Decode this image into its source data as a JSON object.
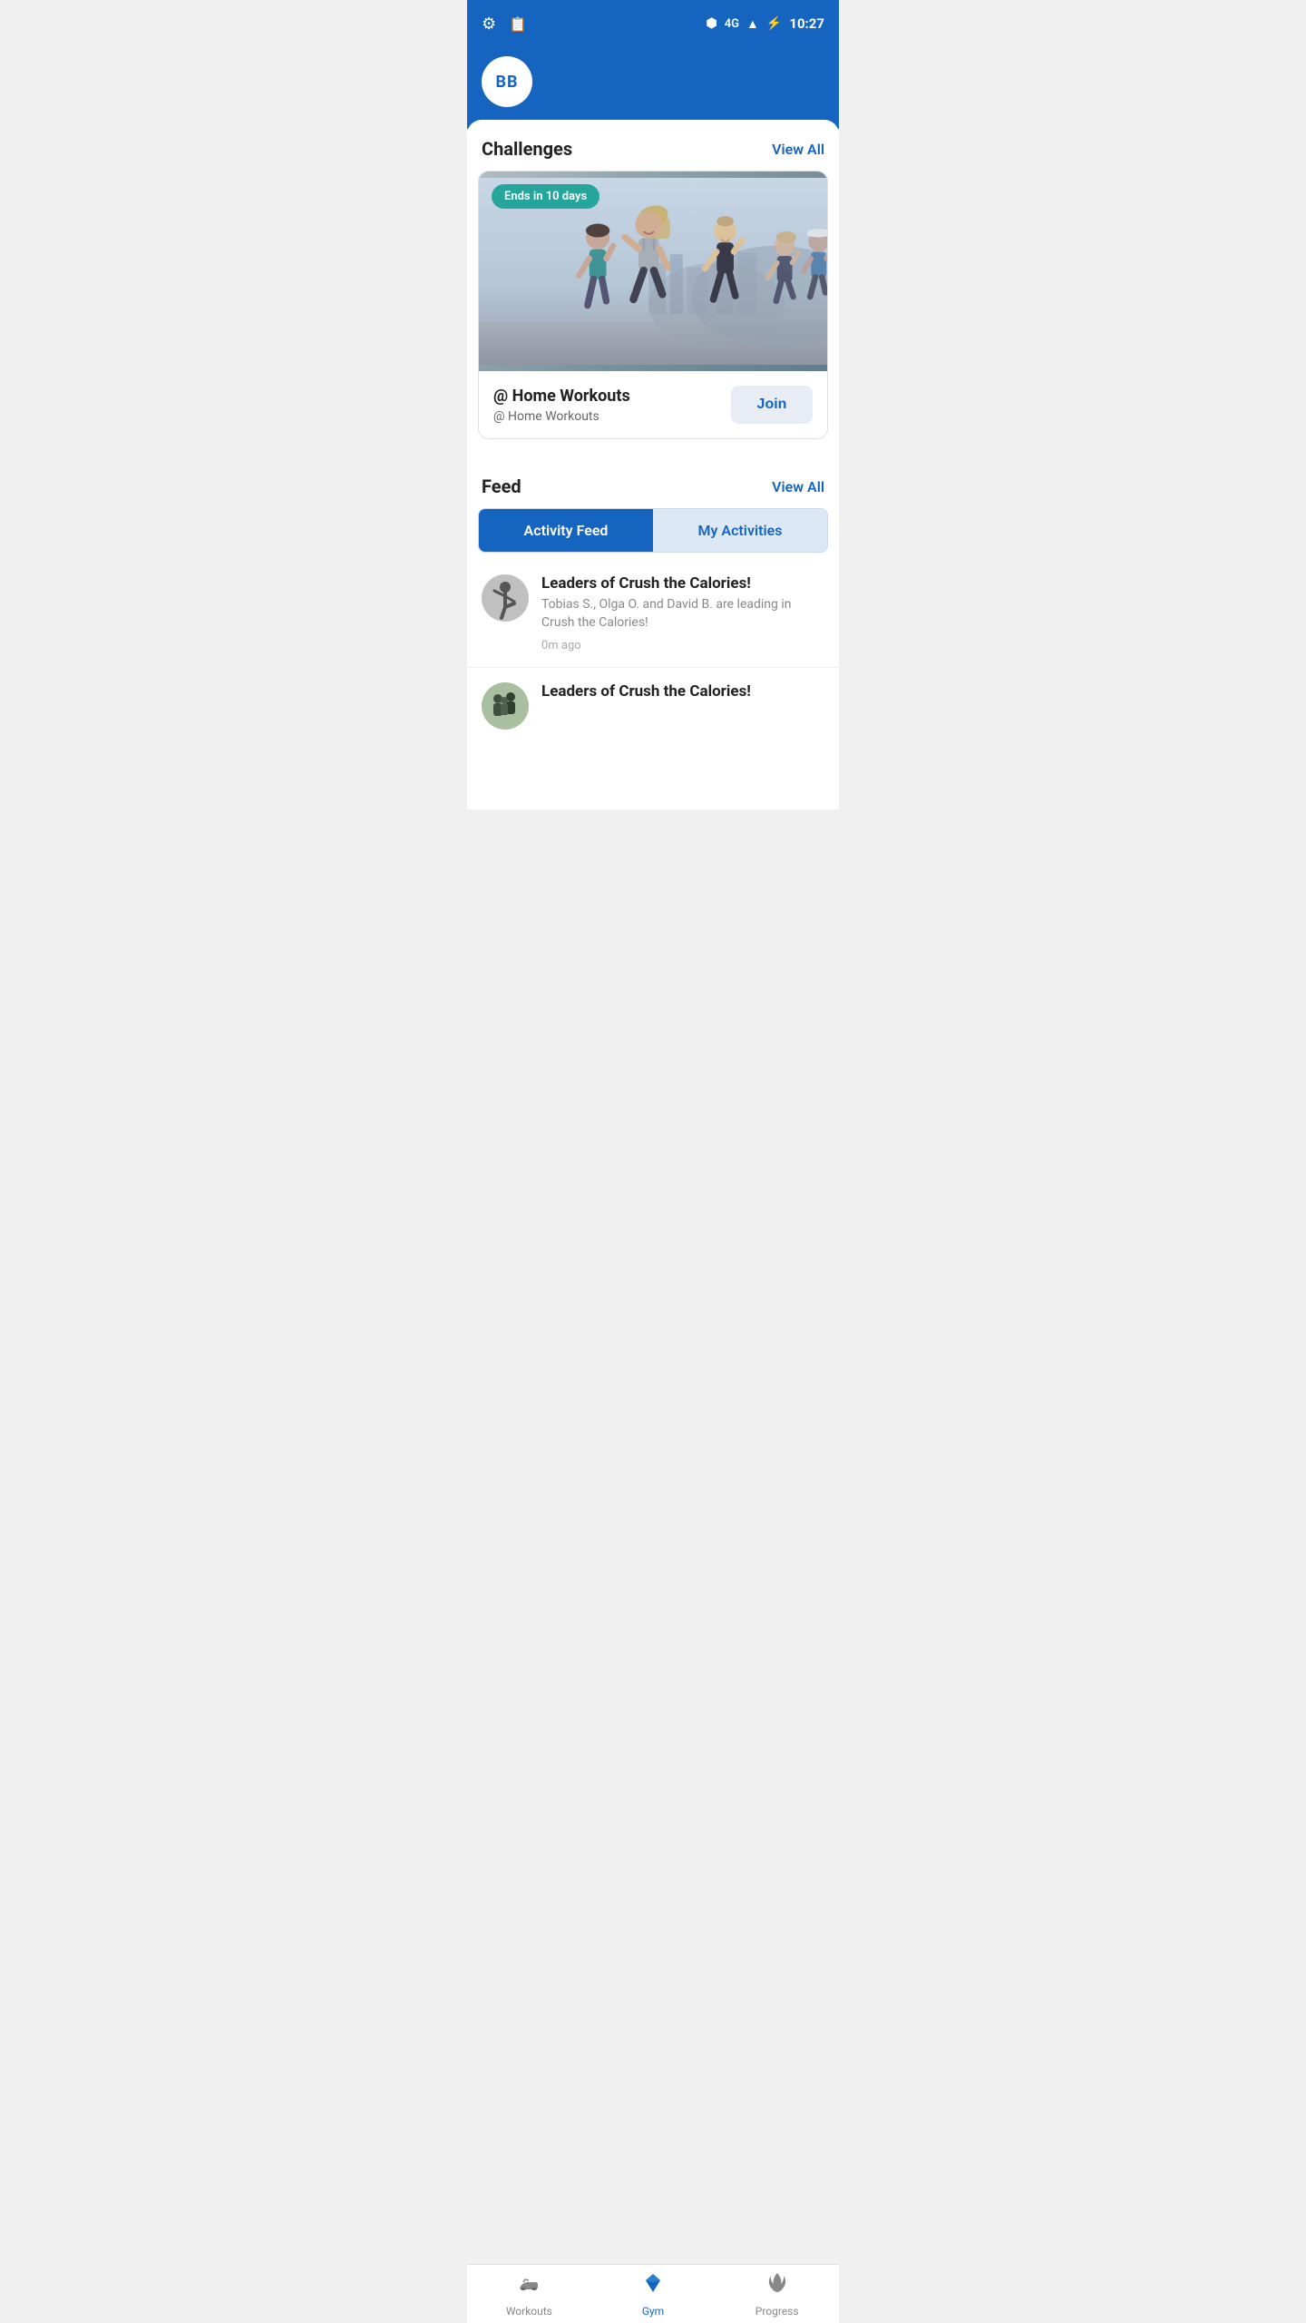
{
  "statusBar": {
    "time": "10:27",
    "signal": "4G"
  },
  "appBar": {
    "userInitials": "BB"
  },
  "settings": {
    "icon": "⚙"
  },
  "challenges": {
    "title": "Challenges",
    "viewAll": "View All",
    "card": {
      "badge": "Ends in 10 days",
      "title": "@ Home Workouts",
      "subtitle": "@ Home Workouts",
      "joinLabel": "Join"
    }
  },
  "feed": {
    "title": "Feed",
    "viewAll": "View All",
    "tabs": [
      {
        "id": "activity",
        "label": "Activity Feed",
        "active": true
      },
      {
        "id": "my",
        "label": "My Activities",
        "active": false
      }
    ],
    "items": [
      {
        "id": 1,
        "title": "Leaders of Crush the Calories!",
        "body": "Tobias S., Olga O. and David B. are leading in Crush the Calories!",
        "time": "0m ago",
        "avatarType": "yoga"
      },
      {
        "id": 2,
        "title": "Leaders of Crush the Calories!",
        "body": "",
        "time": "",
        "avatarType": "group"
      }
    ]
  },
  "bottomNav": {
    "items": [
      {
        "id": "workouts",
        "label": "Workouts",
        "active": false
      },
      {
        "id": "gym",
        "label": "Gym",
        "active": true
      },
      {
        "id": "progress",
        "label": "Progress",
        "active": false
      }
    ]
  }
}
